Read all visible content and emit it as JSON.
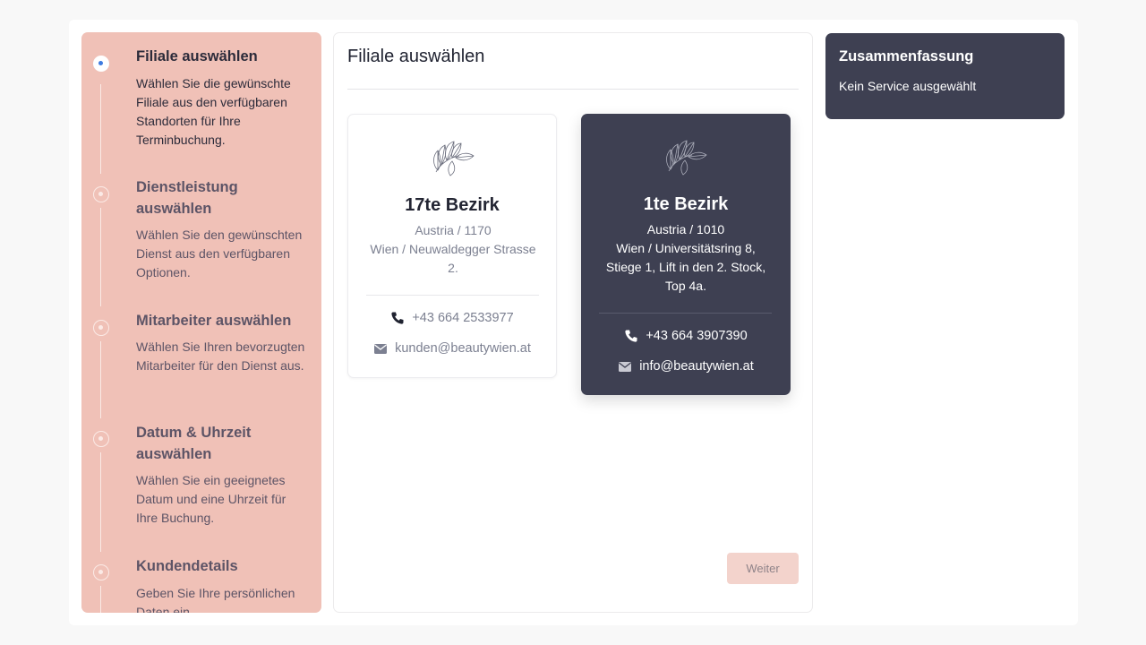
{
  "steps": [
    {
      "title": "Filiale auswählen",
      "description": "Wählen Sie die gewünschte Filiale aus den verfügbaren Standorten für Ihre Terminbuchung."
    },
    {
      "title": "Dienstleistung auswählen",
      "description": "Wählen Sie den gewünschten Dienst aus den verfügbaren Optionen."
    },
    {
      "title": "Mitarbeiter auswählen",
      "description": "Wählen Sie Ihren bevorzugten Mitarbeiter für den Dienst aus."
    },
    {
      "title": "Datum & Uhrzeit auswählen",
      "description": "Wählen Sie ein geeignetes Datum und eine Uhrzeit für Ihre Buchung."
    },
    {
      "title": "Kundendetails",
      "description": "Geben Sie Ihre persönlichen Daten ein."
    }
  ],
  "main": {
    "title": "Filiale auswählen",
    "next_label": "Weiter"
  },
  "branches": [
    {
      "name": "17te Bezirk",
      "country_zip": "Austria / 1170",
      "street": "Wien / Neuwaldegger Strasse 2.",
      "phone": "+43 664 2533977",
      "email": "kunden@beautywien.at",
      "selected": false
    },
    {
      "name": "1te Bezirk",
      "country_zip": "Austria / 1010",
      "street": "Wien / Universitätsring 8, Stiege 1, Lift in den 2. Stock, Top 4a.",
      "phone": "+43 664 3907390",
      "email": "info@beautywien.at",
      "selected": true
    }
  ],
  "summary": {
    "title": "Zusammenfassung",
    "text": "Kein Service ausgewählt"
  },
  "colors": {
    "accent": "#f0c1b7",
    "dark": "#3e4052",
    "active_dot": "#3d7be0"
  },
  "icons": [
    "leaf-logo-icon",
    "phone-icon",
    "mail-icon",
    "step-dot-icon"
  ]
}
